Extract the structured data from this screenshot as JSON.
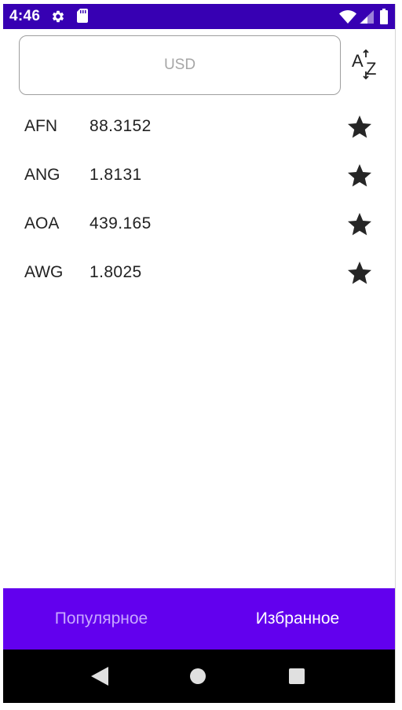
{
  "status_bar": {
    "time": "4:46",
    "icons": [
      "gear-icon",
      "sd-card-icon",
      "wifi-icon",
      "signal-icon",
      "battery-icon"
    ],
    "background": "#3700b3"
  },
  "search": {
    "placeholder": "USD",
    "value": ""
  },
  "sort_button": {
    "icon": "sort-alpha-icon",
    "label_top": "A",
    "label_bottom": "Z"
  },
  "currencies": [
    {
      "code": "AFN",
      "rate": "88.3152",
      "favorite": true
    },
    {
      "code": "ANG",
      "rate": "1.8131",
      "favorite": true
    },
    {
      "code": "AOA",
      "rate": "439.165",
      "favorite": true
    },
    {
      "code": "AWG",
      "rate": "1.8025",
      "favorite": true
    }
  ],
  "bottom_nav": {
    "tabs": [
      {
        "label": "Популярное",
        "active": false
      },
      {
        "label": "Избранное",
        "active": true
      }
    ],
    "background": "#6200ee"
  },
  "system_nav": {
    "icons": [
      "back-icon",
      "home-icon",
      "recents-icon"
    ]
  }
}
